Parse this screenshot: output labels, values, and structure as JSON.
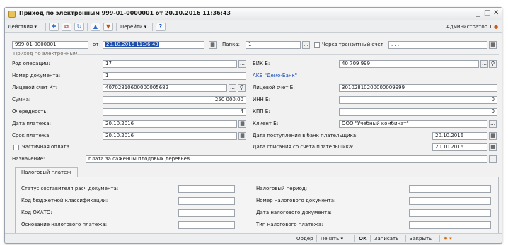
{
  "window": {
    "title": "Приход по электронным 999-01-0000001 от 20.10.2016 11:36:43",
    "minimize": "_",
    "restore": "□",
    "close": "✕"
  },
  "toolbar": {
    "actions_label": "Действия",
    "goto_label": "Перейти",
    "help_label": "?",
    "user_label": "Администратор 1"
  },
  "header": {
    "doc_number": "999-01-0000001",
    "from_label": "от",
    "doc_date": "20.10.2016 11:36:43",
    "folder_label": "Папка:",
    "folder_value": "1",
    "transit_label": "Через транзитный счет",
    "transit_value": ". . ."
  },
  "section": {
    "title": "Приход по электронным"
  },
  "left": {
    "operation_type_label": "Род операции:",
    "operation_type_value": "17",
    "doc_number_label": "Номер документа:",
    "doc_number_value": "1",
    "account_kt_label": "Лицевой счет Кт:",
    "account_kt_value": "40702810600000005682",
    "amount_label": "Сумма:",
    "amount_value": "250 000.00",
    "priority_label": "Очередность:",
    "priority_value": "4",
    "pay_date_label": "Дата платежа:",
    "pay_date_value": "20.10.2016",
    "due_date_label": "Срок платежа:",
    "due_date_value": "20.10.2016",
    "partial_label": "Частичная оплата"
  },
  "right": {
    "bik_label": "БИК Б:",
    "bik_value": "40 709 999",
    "bank_name": "АКБ \"Демо-Банк\"",
    "account_b_label": "Лицевой счет Б:",
    "account_b_value": "30102810200000009999",
    "inn_label": "ИНН Б:",
    "inn_value": "0",
    "kpp_label": "КПП Б:",
    "kpp_value": "0",
    "client_label": "Клиент Б:",
    "client_value": "ООО \"Учебный комбинат\"",
    "received_label": "Дата поступления в банк плательщика:",
    "received_value": "20.10.2016",
    "debited_label": "Дата списания со счета плательщика:",
    "debited_value": "20.10.2016"
  },
  "purpose": {
    "label": "Назначение:",
    "value": "плата за саженцы плодовых деревьев"
  },
  "tax": {
    "tab_label": "Налоговый платеж",
    "status_label": "Статус составителя расч документа:",
    "kbk_label": "Код бюджетной классификации:",
    "okato_label": "Код ОКАТО:",
    "basis_label": "Основание налогового платежа:",
    "period_label": "Налоговый период:",
    "tax_doc_number_label": "Номер налогового документа:",
    "tax_doc_date_label": "Дата налогового документа:",
    "type_label": "Тип налогового платежа:"
  },
  "statusbar": {
    "order_label": "Ордер",
    "print_label": "Печать",
    "ok_label": "OK",
    "save_label": "Записать",
    "close_label": "Закрыть"
  }
}
